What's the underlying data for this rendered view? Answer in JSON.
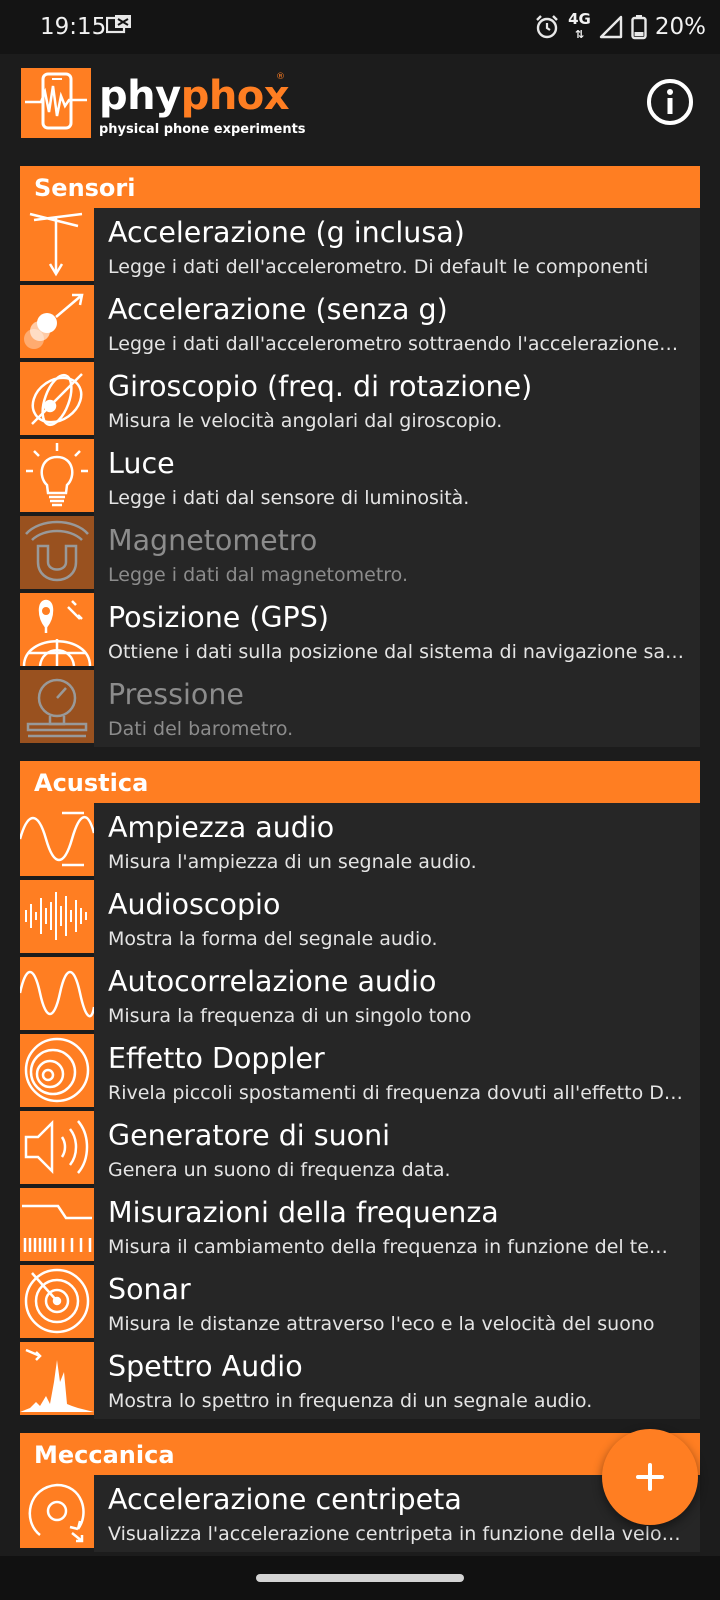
{
  "status_bar": {
    "time": "19:15",
    "network": "4G",
    "battery": "20%"
  },
  "app": {
    "logo_main_a": "phy",
    "logo_main_b": "phox",
    "logo_reg": "®",
    "logo_sub": "physical phone experiments"
  },
  "sections": [
    {
      "title": "Sensori",
      "items": [
        {
          "title": "Accelerazione (g inclusa)",
          "desc": "Legge i dati dell'accelerometro. Di default le componenti",
          "icon": "acceleration-with-g-icon",
          "enabled": true
        },
        {
          "title": "Accelerazione (senza g)",
          "desc": "Legge i dati dall'accelerometro sottraendo l'accelerazione di gravità",
          "icon": "acceleration-without-g-icon",
          "enabled": true
        },
        {
          "title": "Giroscopio (freq. di rotazione)",
          "desc": "Misura le velocità angolari dal giroscopio.",
          "icon": "gyroscope-icon",
          "enabled": true
        },
        {
          "title": "Luce",
          "desc": "Legge i dati dal sensore di luminosità.",
          "icon": "light-bulb-icon",
          "enabled": true
        },
        {
          "title": "Magnetometro",
          "desc": "Legge i dati dal magnetometro.",
          "icon": "magnet-icon",
          "enabled": false
        },
        {
          "title": "Posizione (GPS)",
          "desc": "Ottiene i dati sulla posizione dal sistema di navigazione satellitare",
          "icon": "gps-globe-icon",
          "enabled": true
        },
        {
          "title": "Pressione",
          "desc": "Dati del barometro.",
          "icon": "barometer-icon",
          "enabled": false
        }
      ]
    },
    {
      "title": "Acustica",
      "items": [
        {
          "title": "Ampiezza audio",
          "desc": "Misura l'ampiezza di un segnale audio.",
          "icon": "audio-amplitude-icon",
          "enabled": true
        },
        {
          "title": "Audioscopio",
          "desc": "Mostra la forma del segnale audio.",
          "icon": "audioscope-icon",
          "enabled": true
        },
        {
          "title": "Autocorrelazione audio",
          "desc": "Misura la frequenza di un singolo tono",
          "icon": "autocorrelation-icon",
          "enabled": true
        },
        {
          "title": "Effetto Doppler",
          "desc": "Rivela piccoli spostamenti di frequenza dovuti all'effetto Doppler",
          "icon": "doppler-icon",
          "enabled": true
        },
        {
          "title": "Generatore di suoni",
          "desc": "Genera un suono di frequenza data.",
          "icon": "speaker-icon",
          "enabled": true
        },
        {
          "title": "Misurazioni della frequenza",
          "desc": "Misura il cambiamento della frequenza in funzione del tempo",
          "icon": "frequency-history-icon",
          "enabled": true
        },
        {
          "title": "Sonar",
          "desc": "Misura le distanze attraverso l'eco e la velocità del suono",
          "icon": "sonar-icon",
          "enabled": true
        },
        {
          "title": "Spettro Audio",
          "desc": "Mostra lo spettro in frequenza di un segnale audio.",
          "icon": "audio-spectrum-icon",
          "enabled": true
        }
      ]
    },
    {
      "title": "Meccanica",
      "items": [
        {
          "title": "Accelerazione centripeta",
          "desc": "Visualizza l'accelerazione centripeta in funzione della velocità angolare",
          "icon": "centripetal-icon",
          "enabled": true
        }
      ]
    }
  ],
  "colors": {
    "accent": "#ff7e22",
    "background": "#1c1c1c",
    "item_background": "#262626"
  }
}
